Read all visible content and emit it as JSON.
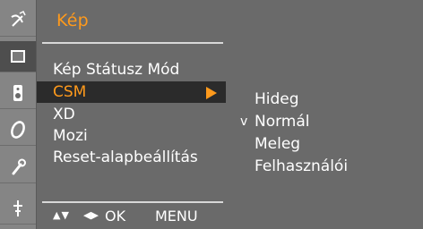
{
  "menu": {
    "title": "Kép",
    "items": [
      {
        "label": "Kép Státusz Mód"
      },
      {
        "label": "CSM"
      },
      {
        "label": "XD"
      },
      {
        "label": "Mozi"
      },
      {
        "label": "Reset-alapbeállítás"
      }
    ]
  },
  "footer": {
    "nav_updown": "▲▼",
    "nav_leftright": "◀▶",
    "ok_label": "OK",
    "menu_label": "MENU"
  },
  "submenu": {
    "items": [
      {
        "label": "Hideg"
      },
      {
        "label": "Normál",
        "checked_glyph": "v"
      },
      {
        "label": "Meleg"
      },
      {
        "label": "Felhasználói"
      }
    ]
  },
  "sidebar_icons": [
    "satellite-dish-icon",
    "picture-icon",
    "speaker-icon",
    "clock-icon",
    "wrench-icon",
    "input-plug-icon"
  ],
  "colors": {
    "accent": "#ff9a1c",
    "background": "#6a6a6a",
    "highlight": "#2b2b2b"
  }
}
